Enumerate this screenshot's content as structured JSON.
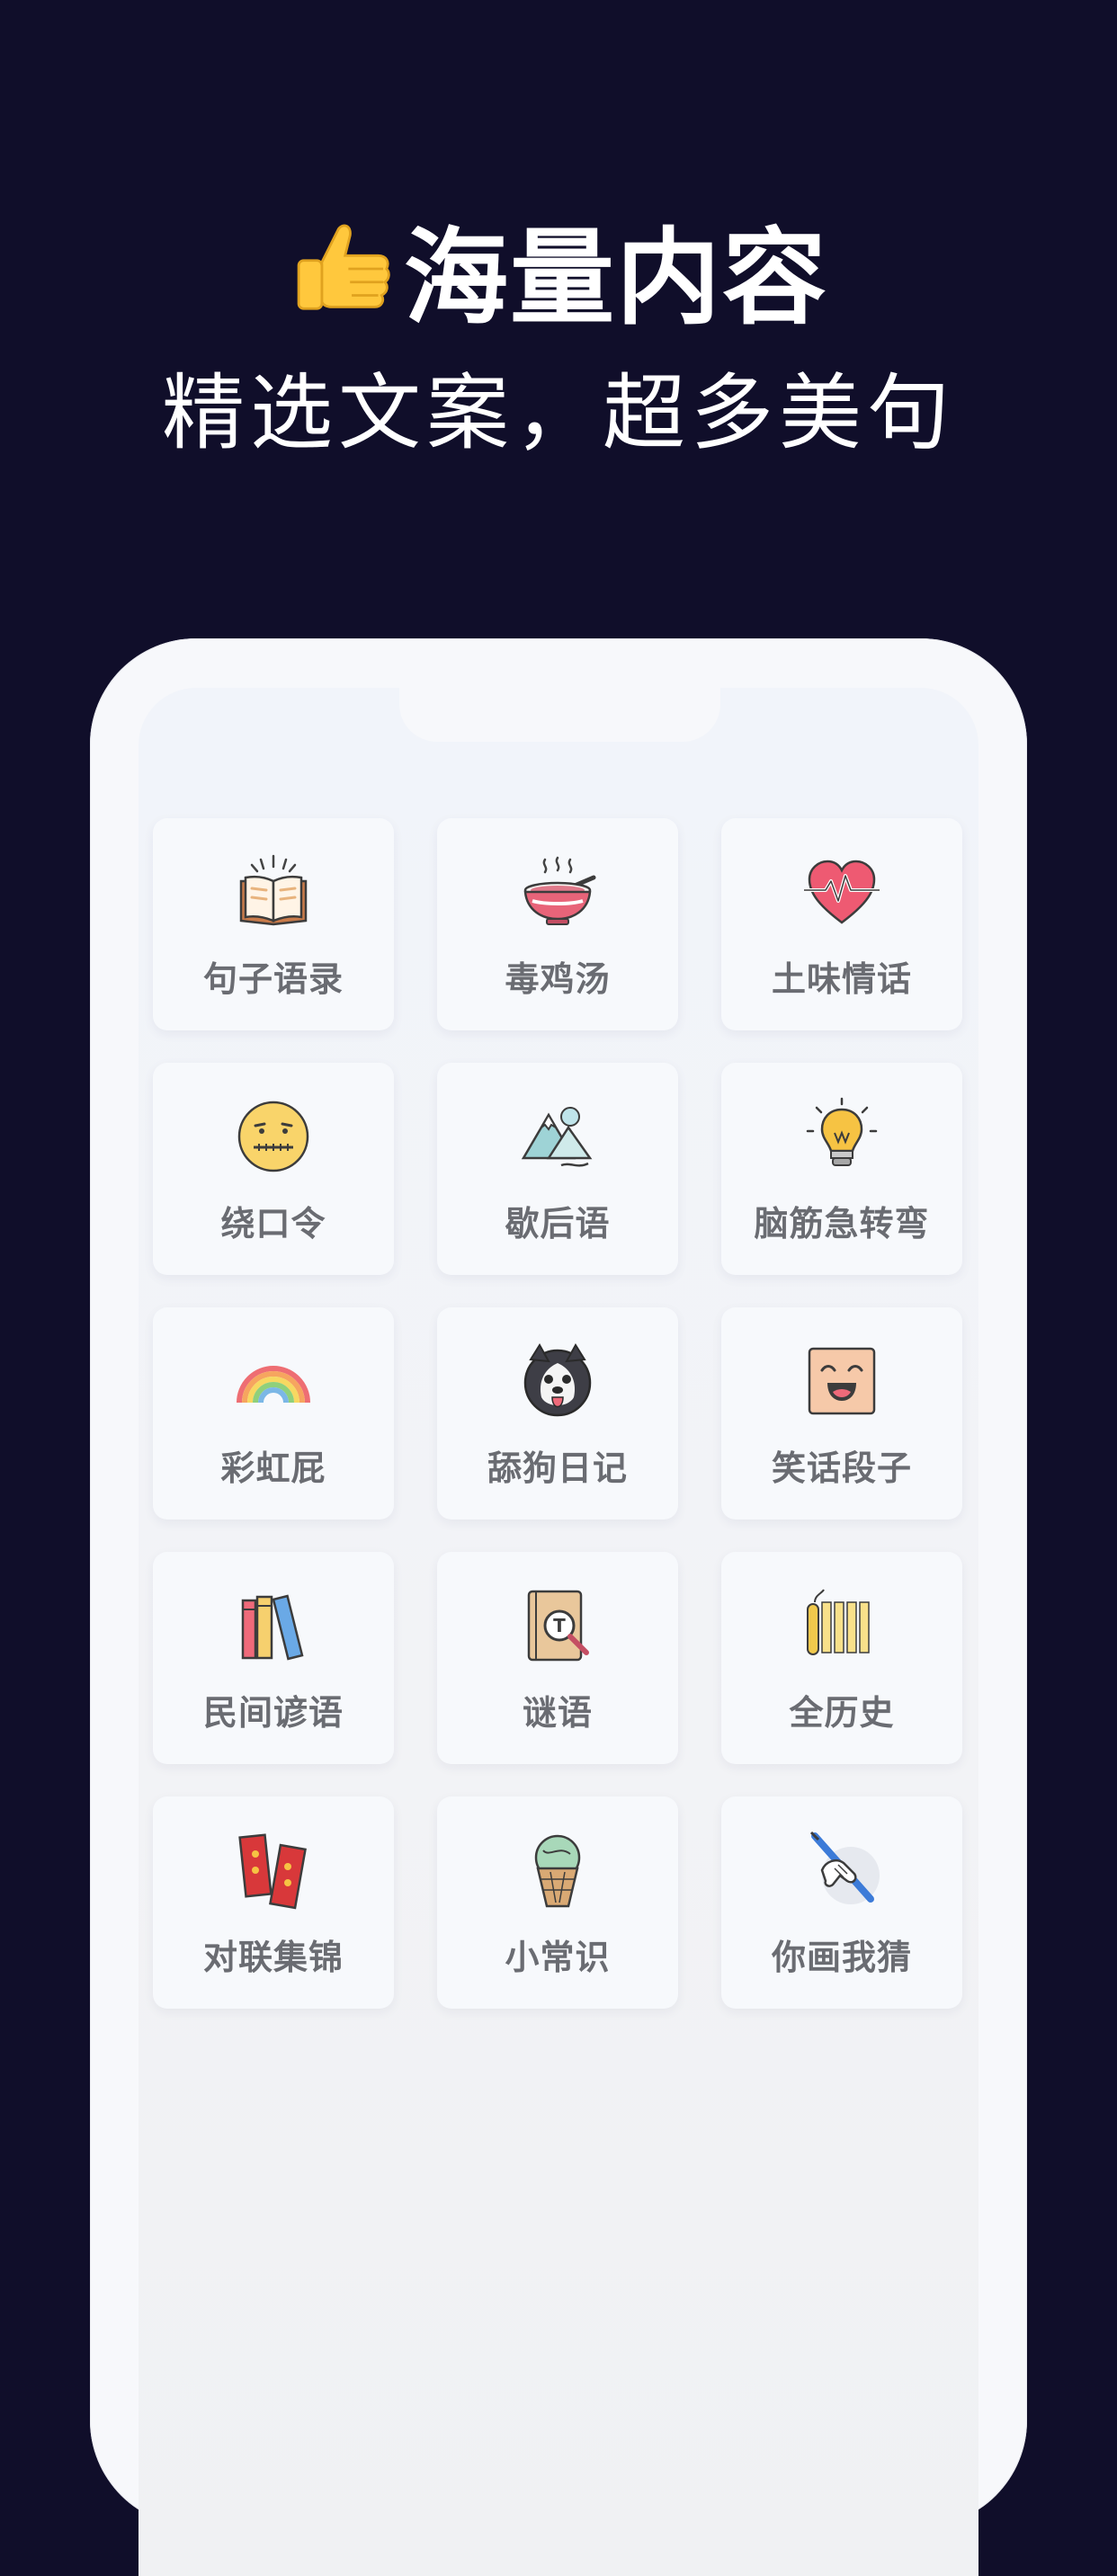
{
  "header": {
    "title": "海量内容",
    "subtitle": "精选文案，超多美句",
    "title_icon": "thumbs-up-icon"
  },
  "categories": [
    {
      "label": "句子语录",
      "icon": "open-book-icon"
    },
    {
      "label": "毒鸡汤",
      "icon": "soup-bowl-icon"
    },
    {
      "label": "土味情话",
      "icon": "heartbeat-icon"
    },
    {
      "label": "绕口令",
      "icon": "zipper-mouth-face-icon"
    },
    {
      "label": "歇后语",
      "icon": "mountain-icon"
    },
    {
      "label": "脑筋急转弯",
      "icon": "lightbulb-icon"
    },
    {
      "label": "彩虹屁",
      "icon": "rainbow-icon"
    },
    {
      "label": "舔狗日记",
      "icon": "husky-dog-icon"
    },
    {
      "label": "笑话段子",
      "icon": "smiling-square-face-icon"
    },
    {
      "label": "民间谚语",
      "icon": "books-icon"
    },
    {
      "label": "谜语",
      "icon": "magnifier-book-icon"
    },
    {
      "label": "全历史",
      "icon": "bamboo-scroll-icon"
    },
    {
      "label": "对联集锦",
      "icon": "couplet-scrolls-icon"
    },
    {
      "label": "小常识",
      "icon": "ice-cream-icon"
    },
    {
      "label": "你画我猜",
      "icon": "drawing-hand-icon"
    }
  ],
  "colors": {
    "background": "#100e2a",
    "card": "#f7f9fc",
    "label": "#6a6c72"
  }
}
